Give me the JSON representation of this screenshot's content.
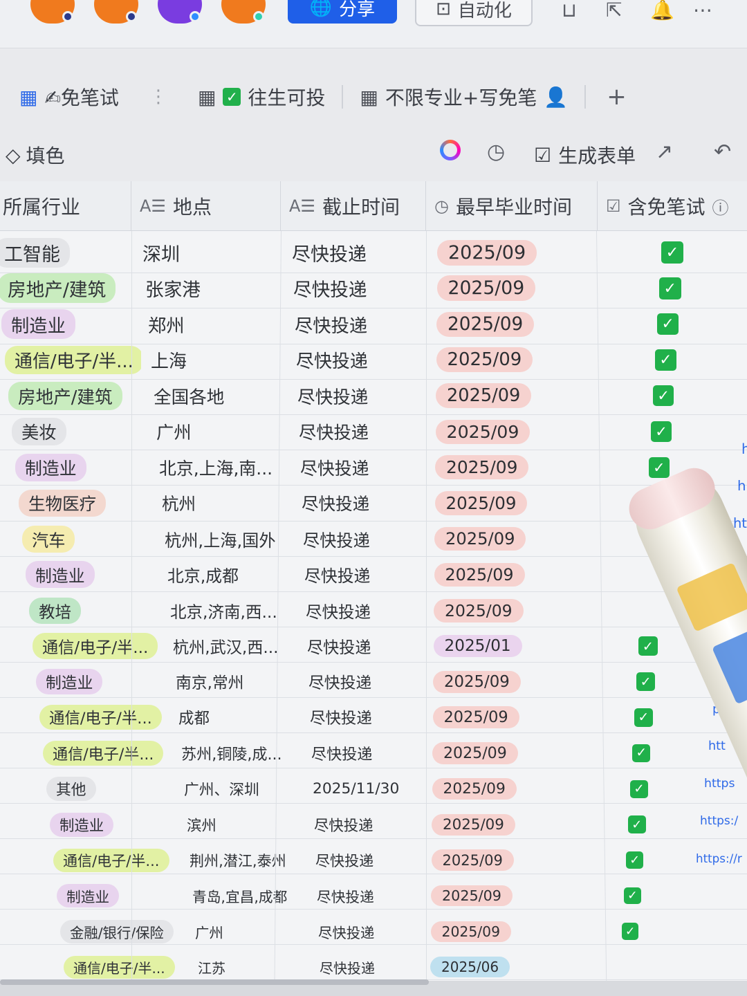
{
  "topbar": {
    "share_label": "分享",
    "automation_label": "自动化",
    "avatars": [
      {
        "color": "#f07a1e",
        "dot": "#2b3a8c"
      },
      {
        "color": "#f07a1e",
        "dot": "#2b3a8c"
      },
      {
        "color": "#7a3ce0",
        "dot": "#2f8cff"
      },
      {
        "color": "#f07a1e",
        "dot": "#2fd0b0"
      }
    ],
    "icons": [
      "lock-icon",
      "share-icon",
      "bell-icon",
      "more-icon"
    ]
  },
  "tabs": [
    {
      "label": "✍免笔试",
      "active": true
    },
    {
      "label": "往生可投",
      "active": false
    },
    {
      "label": "不限专业+写免笔",
      "active": false
    }
  ],
  "tabs_more": "⋮",
  "tabs_add": "+",
  "toolbar": {
    "fill_label": "填色",
    "generate_form_label": "生成表单"
  },
  "columns": [
    {
      "label": "所属行业",
      "icon": ""
    },
    {
      "label": "地点",
      "icon": "A☰"
    },
    {
      "label": "截止时间",
      "icon": "A☰"
    },
    {
      "label": "最早毕业时间",
      "icon": "◷"
    },
    {
      "label": "含免笔试",
      "icon": "☑"
    }
  ],
  "rows": [
    {
      "industry": "工智能",
      "industry_color": "#e4e5e8",
      "location": "深圳",
      "deadline": "尽快投递",
      "grad": "2025/09",
      "grad_color": "#f6d2cf",
      "checked": true
    },
    {
      "industry": "房地产/建筑",
      "industry_color": "#c9ecbf",
      "location": "张家港",
      "deadline": "尽快投递",
      "grad": "2025/09",
      "grad_color": "#f6d2cf",
      "checked": true
    },
    {
      "industry": "制造业",
      "industry_color": "#e8d4ee",
      "location": "郑州",
      "deadline": "尽快投递",
      "grad": "2025/09",
      "grad_color": "#f6d2cf",
      "checked": true
    },
    {
      "industry": "通信/电子/半...",
      "industry_color": "#e2f1a4",
      "location": "上海",
      "deadline": "尽快投递",
      "grad": "2025/09",
      "grad_color": "#f6d2cf",
      "checked": true
    },
    {
      "industry": "房地产/建筑",
      "industry_color": "#c9ecbf",
      "location": "全国各地",
      "deadline": "尽快投递",
      "grad": "2025/09",
      "grad_color": "#f6d2cf",
      "checked": true
    },
    {
      "industry": "美妆",
      "industry_color": "#e4e5e8",
      "location": "广州",
      "deadline": "尽快投递",
      "grad": "2025/09",
      "grad_color": "#f6d2cf",
      "checked": true
    },
    {
      "industry": "制造业",
      "industry_color": "#e8d4ee",
      "location": "北京,上海,南...",
      "deadline": "尽快投递",
      "grad": "2025/09",
      "grad_color": "#f6d2cf",
      "checked": true
    },
    {
      "industry": "生物医疗",
      "industry_color": "#f3d8cf",
      "location": "杭州",
      "deadline": "尽快投递",
      "grad": "2025/09",
      "grad_color": "#f6d2cf",
      "checked": false
    },
    {
      "industry": "汽车",
      "industry_color": "#f5ecb0",
      "location": "杭州,上海,国外",
      "deadline": "尽快投递",
      "grad": "2025/09",
      "grad_color": "#f6d2cf",
      "checked": false
    },
    {
      "industry": "制造业",
      "industry_color": "#e8d4ee",
      "location": "北京,成都",
      "deadline": "尽快投递",
      "grad": "2025/09",
      "grad_color": "#f6d2cf",
      "checked": false
    },
    {
      "industry": "教培",
      "industry_color": "#bfe6c6",
      "location": "北京,济南,西...",
      "deadline": "尽快投递",
      "grad": "2025/09",
      "grad_color": "#f6d2cf",
      "checked": false
    },
    {
      "industry": "通信/电子/半...",
      "industry_color": "#e2f1a4",
      "location": "杭州,武汉,西...",
      "deadline": "尽快投递",
      "grad": "2025/01",
      "grad_color": "#ead4ee",
      "checked": true
    },
    {
      "industry": "制造业",
      "industry_color": "#e8d4ee",
      "location": "南京,常州",
      "deadline": "尽快投递",
      "grad": "2025/09",
      "grad_color": "#f6d2cf",
      "checked": true
    },
    {
      "industry": "通信/电子/半...",
      "industry_color": "#e2f1a4",
      "location": "成都",
      "deadline": "尽快投递",
      "grad": "2025/09",
      "grad_color": "#f6d2cf",
      "checked": true
    },
    {
      "industry": "通信/电子/半...",
      "industry_color": "#e2f1a4",
      "location": "苏州,铜陵,成...",
      "deadline": "尽快投递",
      "grad": "2025/09",
      "grad_color": "#f6d2cf",
      "checked": true
    },
    {
      "industry": "其他",
      "industry_color": "#e4e5e8",
      "location": "广州、深圳",
      "deadline": "2025/11/30",
      "grad": "2025/09",
      "grad_color": "#f6d2cf",
      "checked": true
    },
    {
      "industry": "制造业",
      "industry_color": "#e8d4ee",
      "location": "滨州",
      "deadline": "尽快投递",
      "grad": "2025/09",
      "grad_color": "#f6d2cf",
      "checked": true
    },
    {
      "industry": "通信/电子/半...",
      "industry_color": "#e2f1a4",
      "location": "荆州,潜江,泰州",
      "deadline": "尽快投递",
      "grad": "2025/09",
      "grad_color": "#f6d2cf",
      "checked": true
    },
    {
      "industry": "制造业",
      "industry_color": "#e8d4ee",
      "location": "青岛,宜昌,成都",
      "deadline": "尽快投递",
      "grad": "2025/09",
      "grad_color": "#f6d2cf",
      "checked": true
    },
    {
      "industry": "金融/银行/保险",
      "industry_color": "#e4e5e8",
      "location": "广州",
      "deadline": "尽快投递",
      "grad": "2025/09",
      "grad_color": "#f6d2cf",
      "checked": true
    },
    {
      "industry": "通信/电子/半...",
      "industry_color": "#e2f1a4",
      "location": "江苏",
      "deadline": "尽快投递",
      "grad": "2025/06",
      "grad_color": "#bfe0ef",
      "checked": false
    }
  ],
  "links": [
    "h",
    "h",
    "ht",
    "ht",
    "htt",
    "http",
    "http",
    "p",
    "htt",
    "https",
    "https:/",
    "https://r"
  ]
}
